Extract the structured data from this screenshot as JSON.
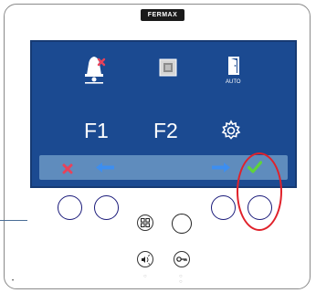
{
  "brand": {
    "logo_text": "FERMAX"
  },
  "screen": {
    "top_row": [
      {
        "icon": "bell-muted-icon"
      },
      {
        "icon": "image-gallery-icon"
      },
      {
        "icon": "door-auto-icon",
        "label": "AUTO"
      }
    ],
    "bottom_row": [
      {
        "label": "F1"
      },
      {
        "label": "F2"
      },
      {
        "icon": "gear-icon"
      }
    ],
    "nav": [
      {
        "icon": "cancel-icon",
        "color": "#e8425a"
      },
      {
        "icon": "arrow-left-icon",
        "color": "#3d8ef0"
      },
      {
        "icon": "arrow-right-icon",
        "color": "#3d8ef0"
      },
      {
        "icon": "check-icon",
        "color": "#5fd43a"
      }
    ]
  },
  "colors": {
    "screen_bg": "#1b4a91",
    "nav_bar": "#5f8cbd",
    "highlight": "#e0212a"
  },
  "buttons": {
    "touch": [
      "touch-button-1",
      "touch-button-2",
      "touch-button-3",
      "touch-button-4"
    ],
    "center": [
      "menu-grid-icon",
      "round-button",
      "sound-icon",
      "key-icon"
    ]
  }
}
